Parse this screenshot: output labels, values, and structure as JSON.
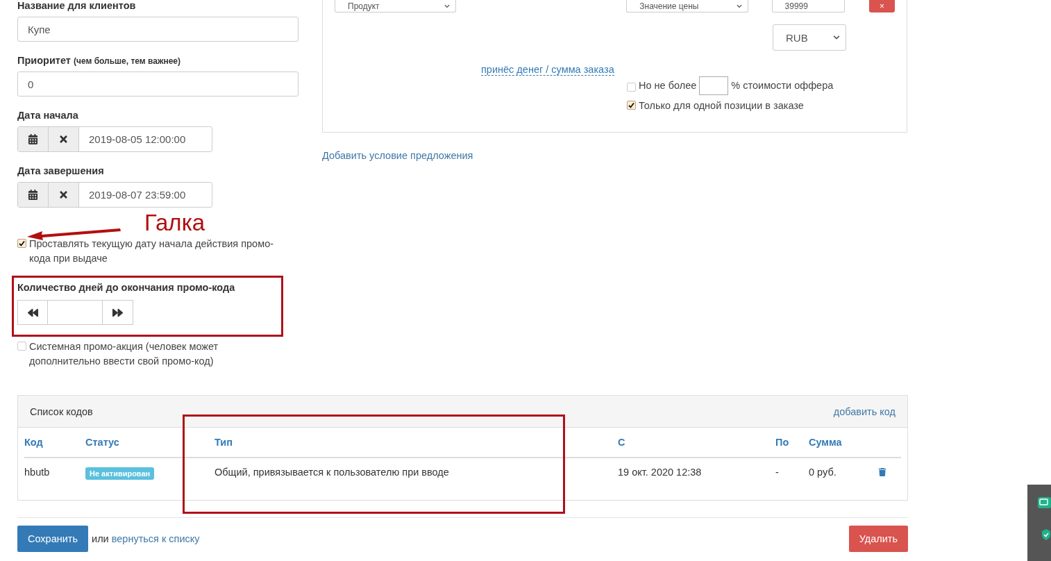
{
  "left_form": {
    "client_name": {
      "label": "Название для клиентов",
      "value": "Купе"
    },
    "priority": {
      "label": "Приоритет",
      "hint": "(чем больше, тем важнее)",
      "value": "0"
    },
    "start_date": {
      "label": "Дата начала",
      "value": "2019-08-05 12:00:00"
    },
    "end_date": {
      "label": "Дата завершения",
      "value": "2019-08-07 23:59:00"
    },
    "current_date_option": {
      "label": "Проставлять текущую дату начала действия промо-кода при выдаче",
      "checked": true
    },
    "days_until_end": {
      "label": "Количество дней до окончания промо-кода"
    },
    "system_promo": {
      "label": "Системная промо-акция (человек может дополнительно ввести свой промо-код)",
      "checked": false
    }
  },
  "offer_condition": {
    "product_select": "Продукт",
    "price_select": "Значение цены",
    "amount": "39999",
    "delete_button": "×",
    "currency": "RUB",
    "ratio_link": "принёс денег / сумма заказа",
    "limit_option": {
      "label_before": "Но не более",
      "label_after": "% стоимости оффера",
      "checked": false
    },
    "single_position_option": {
      "label": "Только для одной позиции в заказе",
      "checked": true
    }
  },
  "add_condition_link": "Добавить условие предложения",
  "codes": {
    "title": "Список кодов",
    "add_link": "добавить код",
    "columns": [
      "Код",
      "Статус",
      "Тип",
      "С",
      "По",
      "Сумма"
    ],
    "rows": [
      {
        "code": "hbutb",
        "status": "Не активирован",
        "type": "Общий, привязывается к пользователю при вводе",
        "from": "19 окт. 2020 12:38",
        "to": "-",
        "sum": "0 руб."
      }
    ]
  },
  "footer": {
    "save_button": "Сохранить",
    "or_text": "или",
    "back_link": "вернуться к списку",
    "delete_button": "Удалить"
  },
  "annotation": {
    "label": "Галка"
  }
}
